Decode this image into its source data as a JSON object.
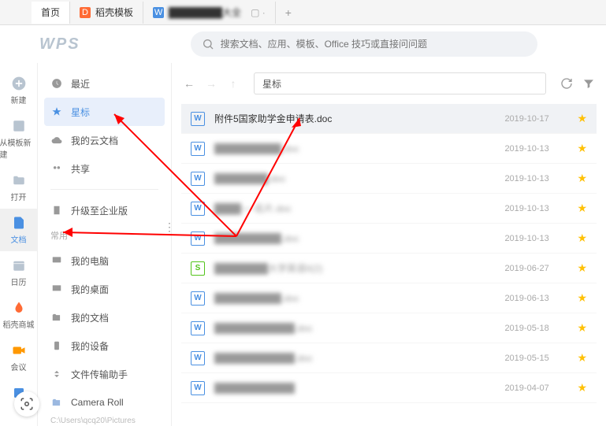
{
  "tabs": [
    {
      "label": "首页",
      "active": true
    },
    {
      "label": "稻壳模板",
      "icon": "orange"
    },
    {
      "label": "████████大全",
      "icon": "blue"
    }
  ],
  "logo": "WPS",
  "search": {
    "placeholder": "搜索文档、应用、模板、Office 技巧或直接问问题"
  },
  "narrowNav": [
    {
      "label": "新建",
      "icon": "plus"
    },
    {
      "label": "从模板新建",
      "icon": "template"
    },
    {
      "label": "打开",
      "icon": "folder"
    },
    {
      "label": "文档",
      "icon": "doc",
      "active": true
    },
    {
      "label": "日历",
      "icon": "calendar"
    },
    {
      "label": "稻壳商城",
      "icon": "shop"
    },
    {
      "label": "会议",
      "icon": "meeting"
    }
  ],
  "categories": {
    "group1": [
      {
        "label": "最近",
        "icon": "clock"
      },
      {
        "label": "星标",
        "icon": "star",
        "active": true
      },
      {
        "label": "我的云文档",
        "icon": "cloud"
      },
      {
        "label": "共享",
        "icon": "share"
      }
    ],
    "group2": [
      {
        "label": "升级至企业版",
        "icon": "building"
      }
    ],
    "group2sub": "常用",
    "group3": [
      {
        "label": "我的电脑",
        "icon": "pc"
      },
      {
        "label": "我的桌面",
        "icon": "desktop"
      },
      {
        "label": "我的文档",
        "icon": "mydoc"
      },
      {
        "label": "我的设备",
        "icon": "device"
      },
      {
        "label": "文件传输助手",
        "icon": "transfer"
      },
      {
        "label": "Camera Roll",
        "icon": "camera"
      }
    ],
    "path": "C:\\Users\\qcq20\\Pictures"
  },
  "breadcrumb": "星标",
  "files": [
    {
      "name": "附件5国家助学金申请表.doc",
      "date": "2019-10-17",
      "type": "W",
      "selected": true
    },
    {
      "name": "██████████.doc",
      "date": "2019-10-13",
      "type": "W",
      "blur": true
    },
    {
      "name": "████████.doc",
      "date": "2019-10-13",
      "type": "W",
      "blur": true
    },
    {
      "name": "████──名片.doc",
      "date": "2019-10-13",
      "type": "W",
      "blur": true
    },
    {
      "name": "██████████.doc",
      "date": "2019-10-13",
      "type": "W",
      "blur": true
    },
    {
      "name": "████████大学英语II(2)",
      "date": "2019-06-27",
      "type": "S",
      "blur": true
    },
    {
      "name": "██████████.doc",
      "date": "2019-06-13",
      "type": "W",
      "blur": true
    },
    {
      "name": "████████████.doc",
      "date": "2019-05-18",
      "type": "W",
      "blur": true
    },
    {
      "name": "████████████.doc",
      "date": "2019-05-15",
      "type": "W",
      "blur": true
    },
    {
      "name": "████████████",
      "date": "2019-04-07",
      "type": "W",
      "blur": true
    }
  ]
}
